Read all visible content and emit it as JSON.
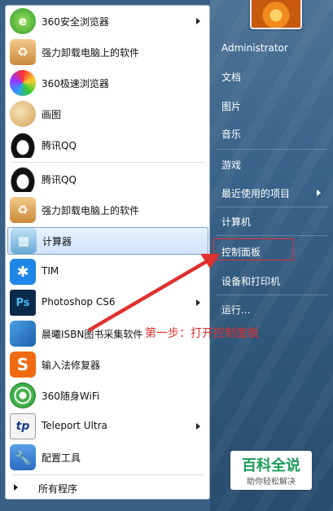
{
  "left_menu": {
    "items": [
      {
        "label": "360安全浏览器",
        "icon": "360-browser-icon",
        "has_submenu": true
      },
      {
        "label": "强力卸载电脑上的软件",
        "icon": "uninstall-box-icon",
        "has_submenu": false
      },
      {
        "label": "360极速浏览器",
        "icon": "360-speed-browser-icon",
        "has_submenu": false
      },
      {
        "label": "画图",
        "icon": "paint-palette-icon",
        "has_submenu": false
      },
      {
        "label": "腾讯QQ",
        "icon": "qq-penguin-icon",
        "has_submenu": false
      },
      {
        "label": "腾讯QQ",
        "icon": "qq-penguin-icon",
        "has_submenu": false
      },
      {
        "label": "强力卸载电脑上的软件",
        "icon": "uninstall-box-icon",
        "has_submenu": false
      },
      {
        "label": "计算器",
        "icon": "calculator-icon",
        "has_submenu": false,
        "selected": true
      },
      {
        "label": "TIM",
        "icon": "tim-icon",
        "has_submenu": false
      },
      {
        "label": "Photoshop CS6",
        "icon": "photoshop-icon",
        "has_submenu": true
      },
      {
        "label": "晨曦ISBN图书采集软件",
        "icon": "book-icon",
        "has_submenu": false
      },
      {
        "label": "输入法修复器",
        "icon": "sogou-s-icon",
        "has_submenu": false
      },
      {
        "label": "360随身WiFi",
        "icon": "wifi-icon",
        "has_submenu": false
      },
      {
        "label": "Teleport Ultra",
        "icon": "teleport-icon",
        "has_submenu": true
      },
      {
        "label": "配置工具",
        "icon": "wrench-icon",
        "has_submenu": false
      }
    ],
    "all_programs": "所有程序"
  },
  "right_menu": {
    "items": [
      {
        "label": "Administrator",
        "has_submenu": false
      },
      {
        "label": "文档",
        "has_submenu": false
      },
      {
        "label": "图片",
        "has_submenu": false
      },
      {
        "label": "音乐",
        "has_submenu": false
      },
      {
        "label": "游戏",
        "has_submenu": false
      },
      {
        "label": "最近使用的项目",
        "has_submenu": true
      },
      {
        "label": "计算机",
        "has_submenu": false
      },
      {
        "label": "控制面板",
        "has_submenu": false,
        "highlighted": true
      },
      {
        "label": "设备和打印机",
        "has_submenu": false
      },
      {
        "label": "运行...",
        "has_submenu": false
      }
    ]
  },
  "annotation": "第一步：打开控制面板",
  "watermark": {
    "title": "百科全说",
    "subtitle": "助你轻松解决"
  },
  "colors": {
    "annotation_red": "#e0302f",
    "panel_blue": "#3a638a",
    "watermark_green": "#1a9b5a"
  }
}
